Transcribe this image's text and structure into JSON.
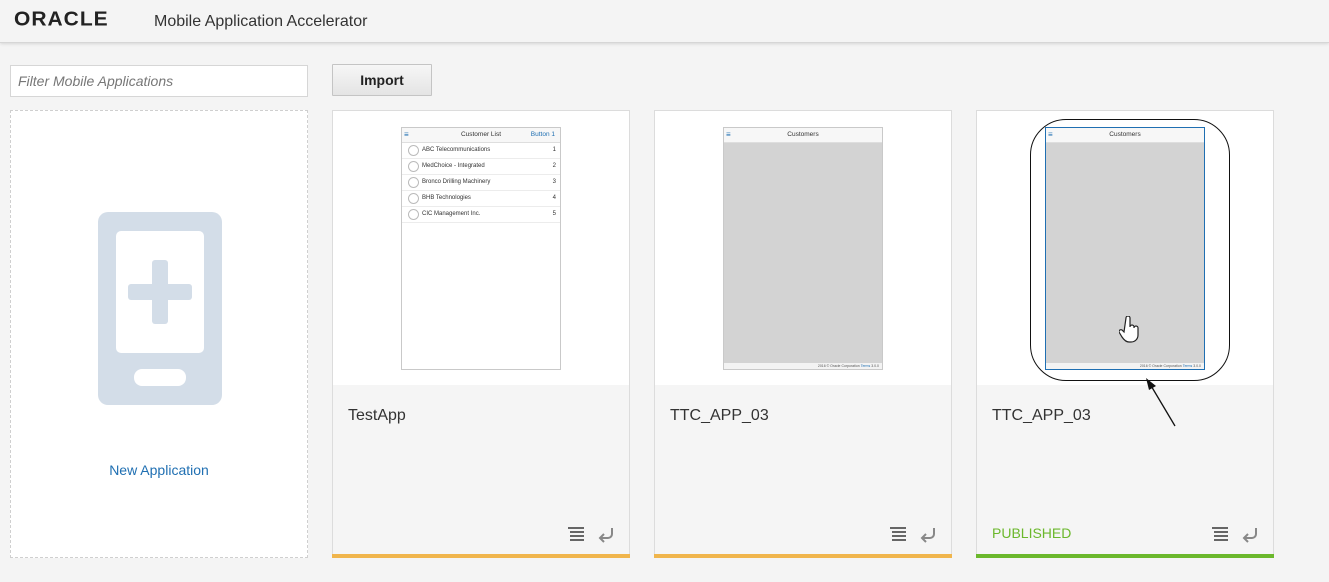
{
  "header": {
    "logo_text": "ORACLE",
    "title": "Mobile Application Accelerator"
  },
  "filter": {
    "placeholder": "Filter Mobile Applications",
    "value": ""
  },
  "toolbar": {
    "import_label": "Import"
  },
  "new_app": {
    "label": "New Application",
    "icon": "add-mobile-icon"
  },
  "colors": {
    "link": "#1f6fb2",
    "stripe_draft": "#f0b54c",
    "stripe_published": "#6bb82c",
    "published_text": "#6bb82c"
  },
  "apps": [
    {
      "name": "TestApp",
      "status": "",
      "preview": {
        "title": "Customer List",
        "button": "Button 1",
        "rows": [
          {
            "name": "ABC Telecommunications",
            "num": "1"
          },
          {
            "name": "MedChoice - Integrated",
            "num": "2"
          },
          {
            "name": "Bronco Drilling Machinery",
            "num": "3"
          },
          {
            "name": "BHB Technologies",
            "num": "4"
          },
          {
            "name": "CIC Management Inc.",
            "num": "5"
          }
        ]
      }
    },
    {
      "name": "TTC_APP_03",
      "status": "",
      "preview": {
        "title": "Customers",
        "footer": "2016 © Oracle Corporation",
        "footer_terms": "Terms",
        "footer_version": "3.0.0"
      }
    },
    {
      "name": "TTC_APP_03",
      "status": "PUBLISHED",
      "preview": {
        "title": "Customers",
        "footer": "2016 © Oracle Corporation",
        "footer_terms": "Terms",
        "footer_version": "3.0.0"
      }
    }
  ],
  "icons": {
    "menu": "≡",
    "details": "list-icon",
    "revert": "undo-icon"
  }
}
